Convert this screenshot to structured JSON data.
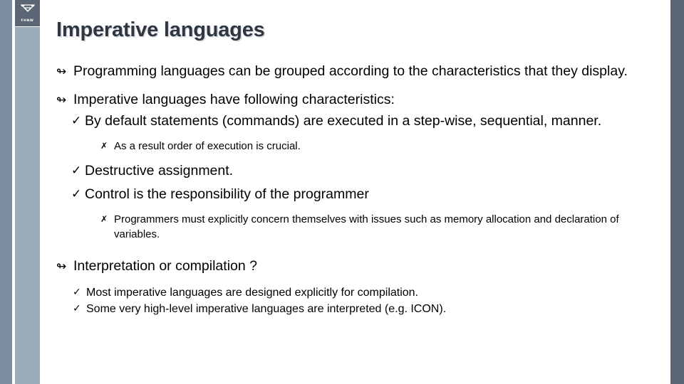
{
  "slide": {
    "title": "Imperative languages",
    "logo": {
      "icon_name": "triangle-logo-mark",
      "wordmark": "FHNW"
    },
    "colors": {
      "title_text": "#2f3640",
      "title_shadow": "#d3d8de",
      "bar_left_dark": "#7b8ca0",
      "bar_left_light": "#9dacbd",
      "bar_right_dark": "#5a6673",
      "body_text": "#000000",
      "background": "#ffffff"
    },
    "bullet_glyphs": {
      "level1": "↬",
      "level2": "✓",
      "level3": "✗"
    },
    "body": [
      {
        "level": 1,
        "bullet": "↬",
        "text": "Programming languages can be grouped according to the characteristics that they display."
      },
      {
        "level": 1,
        "bullet": "↬",
        "text": "Imperative languages have following characteristics:"
      },
      {
        "level": 2,
        "bullet": "✓",
        "text": "By default statements (commands) are executed in a step-wise, sequential, manner."
      },
      {
        "level": 3,
        "bullet": "✗",
        "text": "As a result order of execution is crucial."
      },
      {
        "level": 2,
        "bullet": "✓",
        "text": "Destructive assignment."
      },
      {
        "level": 2,
        "bullet": "✓",
        "text": "Control is the responsibility of the programmer"
      },
      {
        "level": 3,
        "bullet": "✗",
        "text": "Programmers must explicitly concern themselves with issues such as memory allocation and declaration of variables."
      },
      {
        "level": 1,
        "bullet": "↬",
        "text": "Interpretation or compilation ?"
      },
      {
        "level": 2,
        "bullet": "✓",
        "text": "Most imperative languages are designed explicitly for compilation."
      },
      {
        "level": 2,
        "bullet": "✓",
        "text": "Some very high-level imperative languages are interpreted (e.g. ICON)."
      }
    ]
  }
}
